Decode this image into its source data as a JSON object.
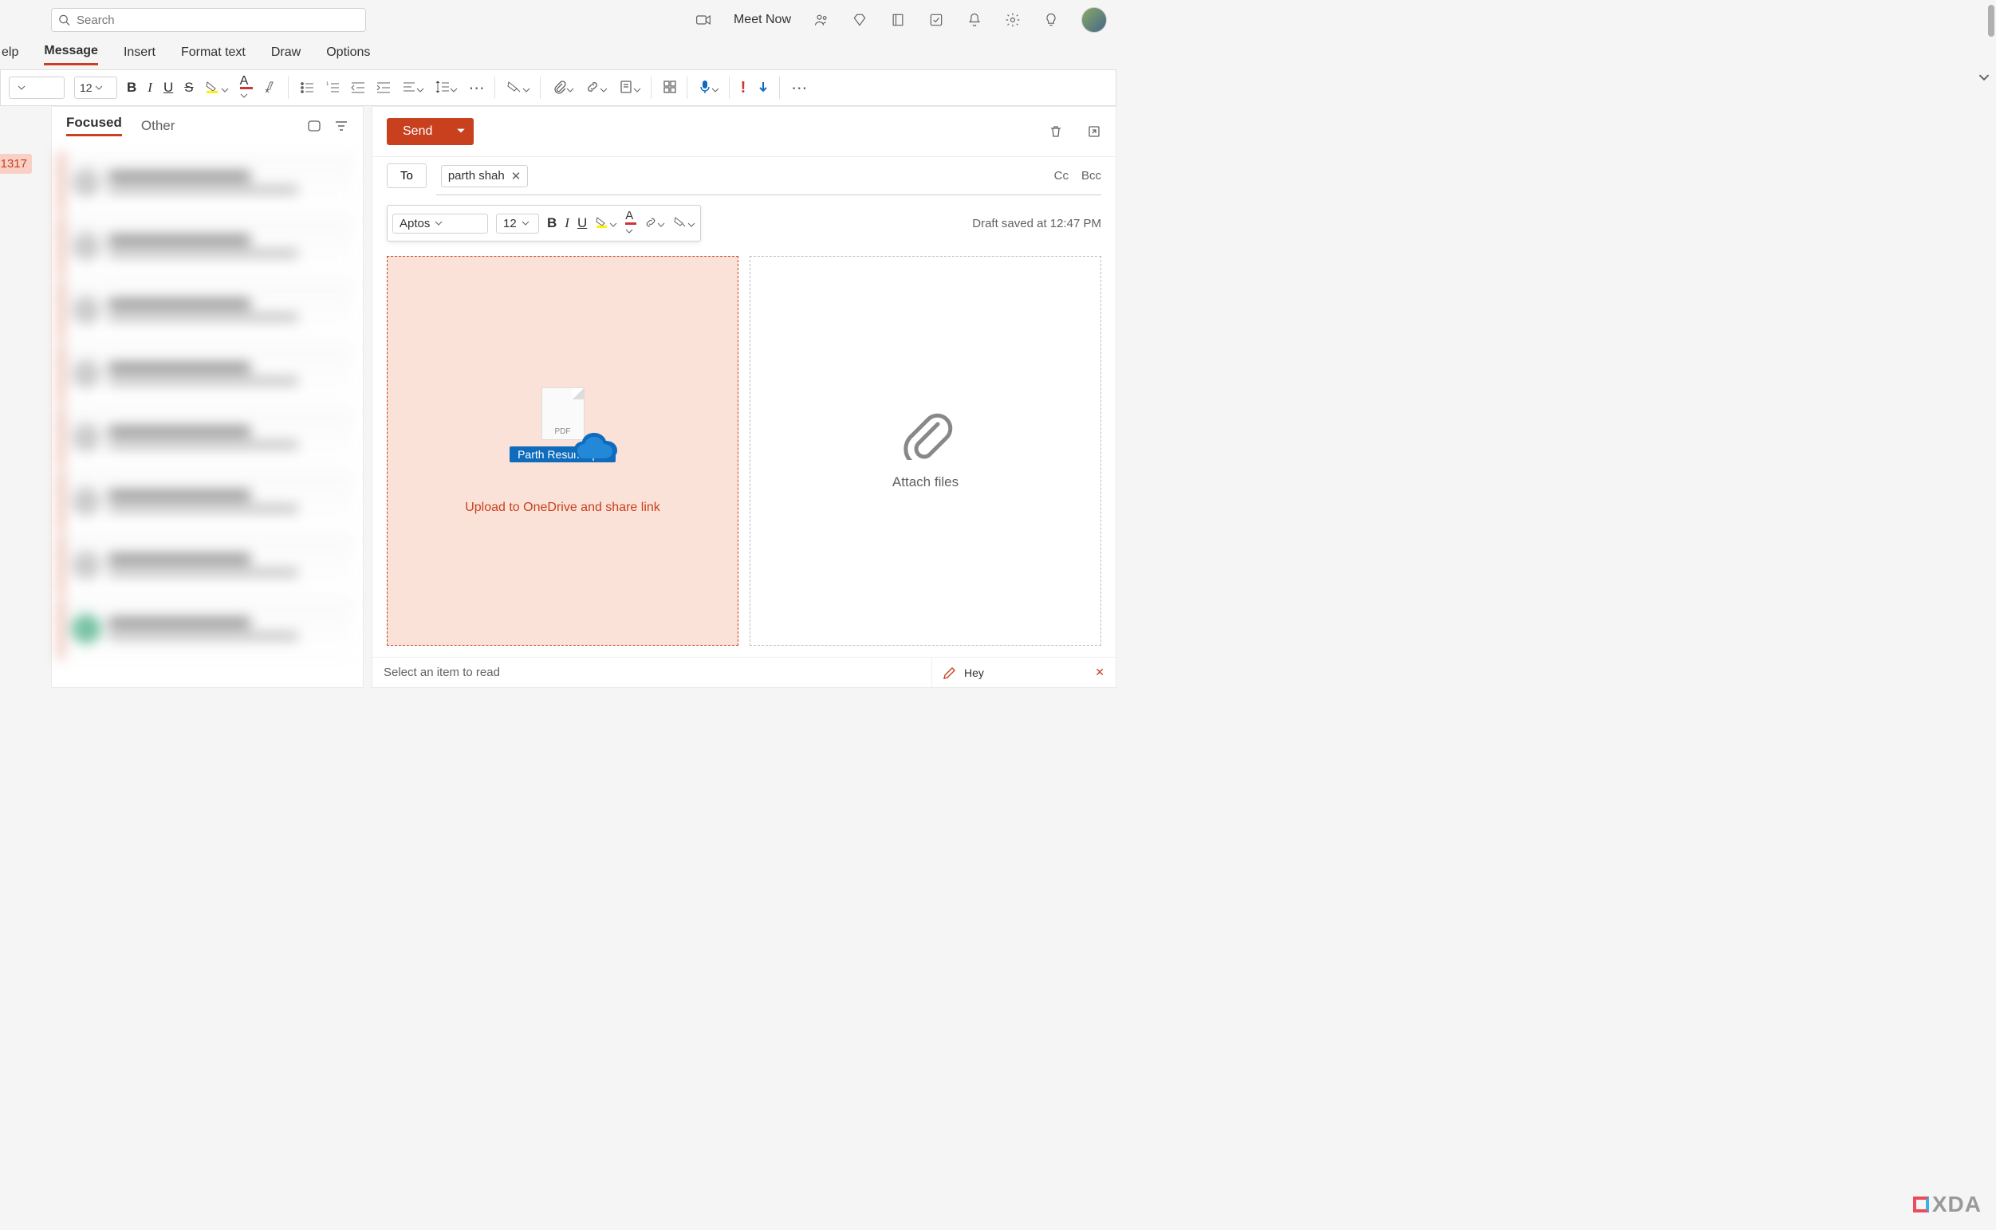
{
  "topbar": {
    "search_placeholder": "Search",
    "meet_now": "Meet Now"
  },
  "tabs": {
    "help": "elp",
    "message": "Message",
    "insert": "Insert",
    "format": "Format text",
    "draw": "Draw",
    "options": "Options"
  },
  "ribbon": {
    "font_size": "12"
  },
  "badge_count": "1317",
  "mail_tabs": {
    "focused": "Focused",
    "other": "Other"
  },
  "compose": {
    "send": "Send",
    "to": "To",
    "recipient": "parth shah",
    "cc": "Cc",
    "bcc": "Bcc",
    "font_name": "Aptos",
    "font_size": "12",
    "draft_saved": "Draft saved at 12:47 PM",
    "file_name": "Parth Resume.pdf",
    "upload_text": "Upload to OneDrive and share link",
    "attach_text": "Attach files"
  },
  "footer": {
    "reading_empty": "Select an item to read",
    "draft_tab": "Hey"
  },
  "watermark": "XDA"
}
